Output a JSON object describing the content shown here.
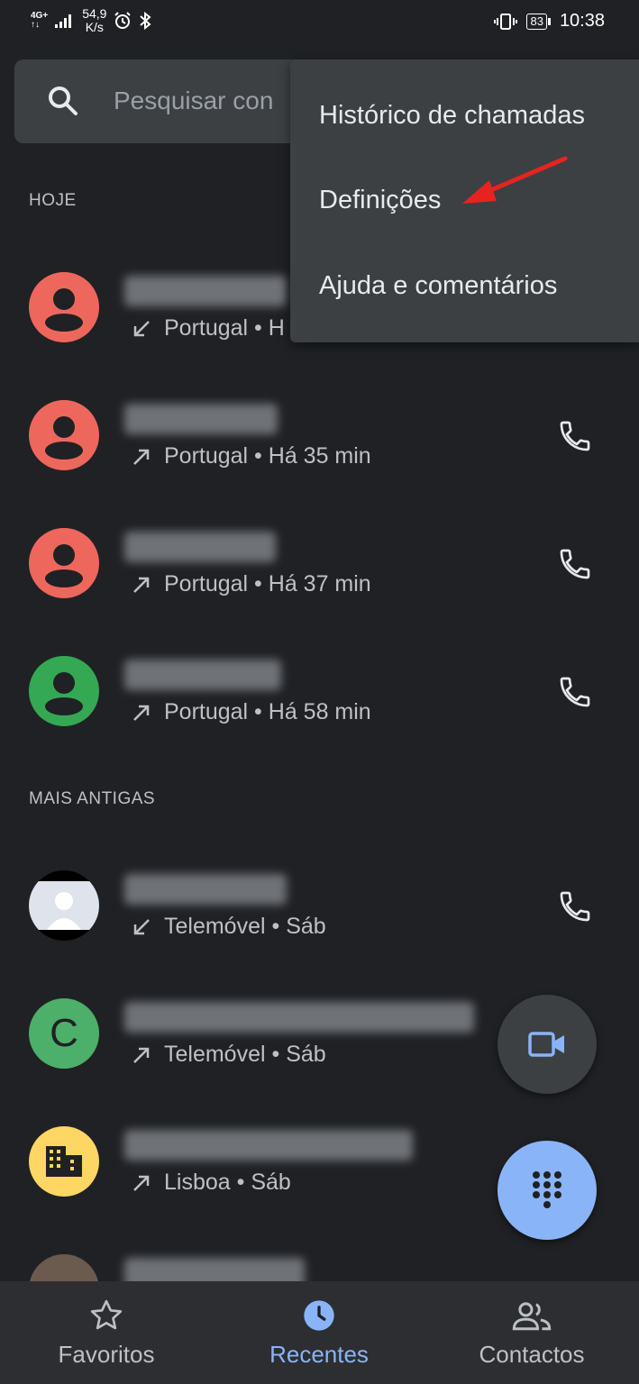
{
  "status_bar": {
    "network_top": "4G+",
    "network_bottom": "↑↓",
    "speed_value": "54,9",
    "speed_unit": "K/s",
    "battery": "83",
    "time": "10:38"
  },
  "search": {
    "placeholder": "Pesquisar con"
  },
  "menu": {
    "items": [
      {
        "label": "Histórico de chamadas"
      },
      {
        "label": "Definições"
      },
      {
        "label": "Ajuda e comentários"
      }
    ]
  },
  "annotation_color": "#e8231f",
  "sections": {
    "today": "HOJE",
    "older": "MAIS ANTIGAS"
  },
  "calls": [
    {
      "avatar": "person",
      "avatar_color": "#ee675c",
      "sub": "Portugal • H",
      "direction": "incoming"
    },
    {
      "avatar": "person",
      "avatar_color": "#ee675c",
      "sub": "Portugal • Há 35 min",
      "direction": "outgoing"
    },
    {
      "avatar": "person",
      "avatar_color": "#ee675c",
      "sub": "Portugal • Há 37 min",
      "direction": "outgoing"
    },
    {
      "avatar": "person",
      "avatar_color": "#34a853",
      "sub": "Portugal • Há 58 min",
      "direction": "outgoing"
    },
    {
      "avatar": "photo",
      "avatar_color": "#e8eaed",
      "sub": "Telemóvel • Sáb",
      "direction": "incoming"
    },
    {
      "avatar": "letter",
      "letter": "C",
      "avatar_color": "#4caf6a",
      "sub": "Telemóvel • Sáb",
      "direction": "outgoing"
    },
    {
      "avatar": "business",
      "avatar_color": "#fdd663",
      "sub": "Lisboa • Sáb",
      "direction": "outgoing"
    }
  ],
  "nav": {
    "favorites": "Favoritos",
    "recents": "Recentes",
    "contacts": "Contactos"
  },
  "colors": {
    "accent": "#8ab4f8",
    "background": "#202124",
    "surface": "#3c4043"
  }
}
